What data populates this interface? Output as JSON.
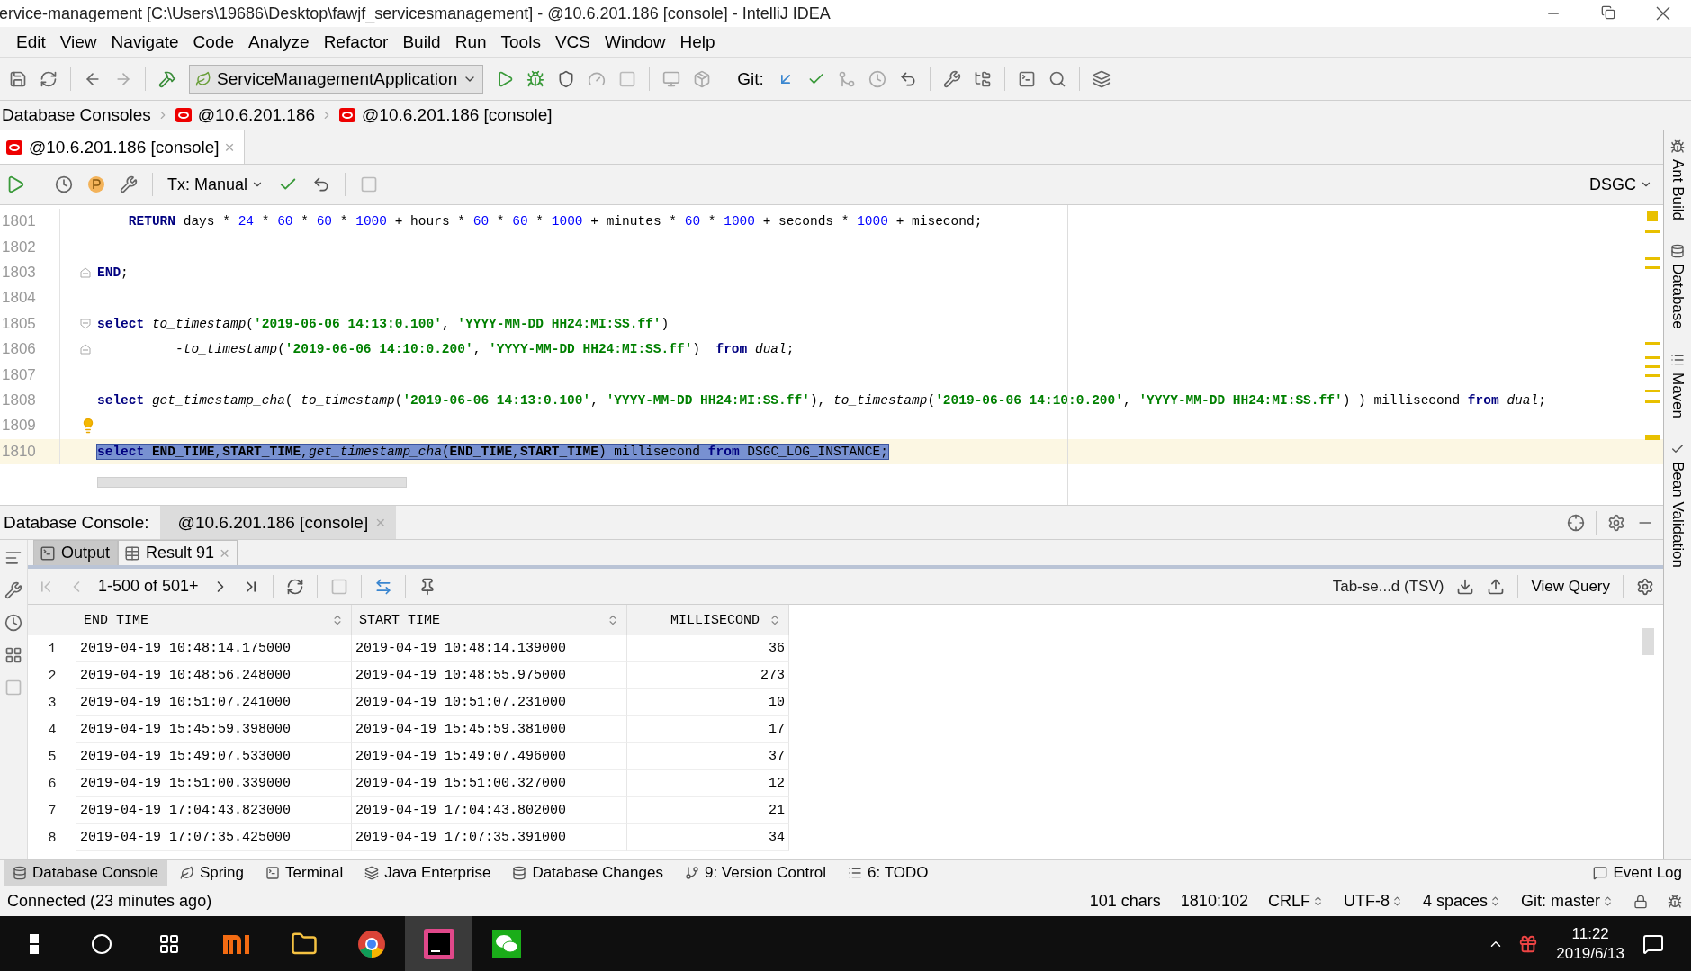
{
  "window": {
    "title": "ervice-management [C:\\Users\\19686\\Desktop\\fawjf_servicesmanagement] - @10.6.201.186 [console] - IntelliJ IDEA"
  },
  "menu": [
    "Edit",
    "View",
    "Navigate",
    "Code",
    "Analyze",
    "Refactor",
    "Build",
    "Run",
    "Tools",
    "VCS",
    "Window",
    "Help"
  ],
  "toolbar": {
    "run_config": "ServiceManagementApplication",
    "git_label": "Git:"
  },
  "breadcrumbs": [
    {
      "label": "Database Consoles",
      "kind": "plain"
    },
    {
      "label": "@10.6.201.186",
      "kind": "db"
    },
    {
      "label": "@10.6.201.186 [console]",
      "kind": "db"
    }
  ],
  "editor_tabs": [
    {
      "label": "@10.6.201.186 [console]",
      "selected": true,
      "close": "×"
    }
  ],
  "console_toolbar": {
    "tx_mode": "Tx: Manual",
    "schema": "DSGC"
  },
  "editor": {
    "lines": [
      {
        "number": "1801",
        "current": false,
        "tokens": [
          {
            "t": "    RETURN",
            "kind": "kw"
          },
          {
            "t": " days * ",
            "kind": "plain"
          },
          {
            "t": "24",
            "kind": "num"
          },
          {
            "t": " * ",
            "kind": "plain"
          },
          {
            "t": "60",
            "kind": "num"
          },
          {
            "t": " * ",
            "kind": "plain"
          },
          {
            "t": "60",
            "kind": "num"
          },
          {
            "t": " * ",
            "kind": "plain"
          },
          {
            "t": "1000",
            "kind": "num"
          },
          {
            "t": " + hours * ",
            "kind": "plain"
          },
          {
            "t": "60",
            "kind": "num"
          },
          {
            "t": " * ",
            "kind": "plain"
          },
          {
            "t": "60",
            "kind": "num"
          },
          {
            "t": " * ",
            "kind": "plain"
          },
          {
            "t": "1000",
            "kind": "num"
          },
          {
            "t": " + minutes * ",
            "kind": "plain"
          },
          {
            "t": "60",
            "kind": "num"
          },
          {
            "t": " * ",
            "kind": "plain"
          },
          {
            "t": "1000",
            "kind": "num"
          },
          {
            "t": " + seconds * ",
            "kind": "plain"
          },
          {
            "t": "1000",
            "kind": "num"
          },
          {
            "t": " + misecond;",
            "kind": "plain"
          }
        ]
      },
      {
        "number": "1802",
        "current": false
      },
      {
        "number": "1803",
        "current": false,
        "kind": "fold_end",
        "tokens": [
          {
            "t": "END",
            "kind": "kw"
          },
          {
            "t": ";",
            "kind": "plain"
          }
        ]
      },
      {
        "number": "1804",
        "current": false
      },
      {
        "number": "1805",
        "current": false,
        "kind": "fold_start",
        "tokens": [
          {
            "t": "select ",
            "kind": "kw"
          },
          {
            "t": "to_timestamp",
            "kind": "fn"
          },
          {
            "t": "(",
            "kind": "plain"
          },
          {
            "t": "'2019-06-06 14:13:0.100'",
            "kind": "str"
          },
          {
            "t": ", ",
            "kind": "plain"
          },
          {
            "t": "'YYYY-MM-DD HH24:MI:SS.ff'",
            "kind": "str"
          },
          {
            "t": ")",
            "kind": "plain"
          }
        ]
      },
      {
        "number": "1806",
        "current": false,
        "kind": "fold_end",
        "tokens": [
          {
            "t": "          -",
            "kind": "plain"
          },
          {
            "t": "to_timestamp",
            "kind": "fn"
          },
          {
            "t": "(",
            "kind": "plain"
          },
          {
            "t": "'2019-06-06 14:10:0.200'",
            "kind": "str"
          },
          {
            "t": ", ",
            "kind": "plain"
          },
          {
            "t": "'YYYY-MM-DD HH24:MI:SS.ff'",
            "kind": "str"
          },
          {
            "t": ")  ",
            "kind": "plain"
          },
          {
            "t": "from ",
            "kind": "kw"
          },
          {
            "t": "dual",
            "kind": "fn"
          },
          {
            "t": ";",
            "kind": "plain"
          }
        ]
      },
      {
        "number": "1807",
        "current": false
      },
      {
        "number": "1808",
        "current": false,
        "tokens": [
          {
            "t": "select ",
            "kind": "kw"
          },
          {
            "t": "get_timestamp_cha",
            "kind": "fn"
          },
          {
            "t": "( ",
            "kind": "plain"
          },
          {
            "t": "to_timestamp",
            "kind": "fn"
          },
          {
            "t": "(",
            "kind": "plain"
          },
          {
            "t": "'2019-06-06 14:13:0.100'",
            "kind": "str"
          },
          {
            "t": ", ",
            "kind": "plain"
          },
          {
            "t": "'YYYY-MM-DD HH24:MI:SS.ff'",
            "kind": "str"
          },
          {
            "t": "), ",
            "kind": "plain"
          },
          {
            "t": "to_timestamp",
            "kind": "fn"
          },
          {
            "t": "(",
            "kind": "plain"
          },
          {
            "t": "'2019-06-06 14:10:0.200'",
            "kind": "str"
          },
          {
            "t": ", ",
            "kind": "plain"
          },
          {
            "t": "'YYYY-MM-DD HH24:MI:SS.ff'",
            "kind": "str"
          },
          {
            "t": ") ) millisecond ",
            "kind": "plain"
          },
          {
            "t": "from ",
            "kind": "kw"
          },
          {
            "t": "dual",
            "kind": "fn"
          },
          {
            "t": ";",
            "kind": "plain"
          }
        ]
      },
      {
        "number": "1809",
        "current": false,
        "bulb": true
      },
      {
        "number": "1810",
        "current": true,
        "selected": true,
        "tokens": [
          {
            "t": "select ",
            "kind": "kw"
          },
          {
            "t": "END_TIME",
            "kind": "col"
          },
          {
            "t": ",",
            "kind": "plain"
          },
          {
            "t": "START_TIME",
            "kind": "col"
          },
          {
            "t": ",",
            "kind": "plain"
          },
          {
            "t": "get_timestamp_cha",
            "kind": "fn"
          },
          {
            "t": "(",
            "kind": "plain"
          },
          {
            "t": "END_TIME",
            "kind": "col"
          },
          {
            "t": ",",
            "kind": "plain"
          },
          {
            "t": "START_TIME",
            "kind": "col"
          },
          {
            "t": ") millisecond ",
            "kind": "plain"
          },
          {
            "t": "from",
            "kind": "kw"
          },
          {
            "t": " DSGC_LOG_INSTANCE;",
            "kind": "plain"
          }
        ]
      }
    ]
  },
  "bottom_panel": {
    "title": "Database Console:",
    "tabs": [
      {
        "label": "@10.6.201.186 [console]",
        "selected": true,
        "close": "×"
      }
    ],
    "result_tabs": [
      {
        "label": "Output",
        "kind": "output",
        "selected": false
      },
      {
        "label": "Result 91",
        "kind": "result",
        "selected": true,
        "close": "×"
      }
    ],
    "paging": "1-500 of 501+",
    "export_format": "Tab-se...d (TSV)",
    "view_query": "View Query",
    "table": {
      "columns": [
        {
          "label": "END_TIME",
          "kind": "text"
        },
        {
          "label": "START_TIME",
          "kind": "text"
        },
        {
          "label": "MILLISECOND",
          "kind": "number"
        }
      ],
      "rows": [
        {
          "n": "1",
          "cells": [
            "2019-04-19 10:48:14.175000",
            "2019-04-19 10:48:14.139000",
            "36"
          ]
        },
        {
          "n": "2",
          "cells": [
            "2019-04-19 10:48:56.248000",
            "2019-04-19 10:48:55.975000",
            "273"
          ]
        },
        {
          "n": "3",
          "cells": [
            "2019-04-19 10:51:07.241000",
            "2019-04-19 10:51:07.231000",
            "10"
          ]
        },
        {
          "n": "4",
          "cells": [
            "2019-04-19 15:45:59.398000",
            "2019-04-19 15:45:59.381000",
            "17"
          ]
        },
        {
          "n": "5",
          "cells": [
            "2019-04-19 15:49:07.533000",
            "2019-04-19 15:49:07.496000",
            "37"
          ]
        },
        {
          "n": "6",
          "cells": [
            "2019-04-19 15:51:00.339000",
            "2019-04-19 15:51:00.327000",
            "12"
          ]
        },
        {
          "n": "7",
          "cells": [
            "2019-04-19 17:04:43.823000",
            "2019-04-19 17:04:43.802000",
            "21"
          ]
        },
        {
          "n": "8",
          "cells": [
            "2019-04-19 17:07:35.425000",
            "2019-04-19 17:07:35.391000",
            "34"
          ]
        }
      ]
    }
  },
  "side_tools": [
    "Ant Build",
    "Database",
    "Maven",
    "Bean Validation"
  ],
  "tool_windows": [
    {
      "label": "Database Console",
      "selected": true
    },
    {
      "label": "Spring",
      "selected": false
    },
    {
      "label": "Terminal",
      "selected": false
    },
    {
      "label": "Java Enterprise",
      "selected": false
    },
    {
      "label": "Database Changes",
      "selected": false
    },
    {
      "label": "9: Version Control",
      "selected": false
    },
    {
      "label": "6: TODO",
      "selected": false
    }
  ],
  "event_log": "Event Log",
  "status_bar": {
    "message": "Connected (23 minutes ago)",
    "items": [
      {
        "label": "101 chars",
        "kind": "text"
      },
      {
        "label": "1810:102",
        "kind": "text"
      },
      {
        "label": "CRLF",
        "kind": "select"
      },
      {
        "label": "UTF-8",
        "kind": "select"
      },
      {
        "label": "4 spaces",
        "kind": "select"
      },
      {
        "label": "Git: master",
        "kind": "select"
      }
    ]
  },
  "taskbar": {
    "time": "11:22",
    "date": "2019/6/13"
  }
}
